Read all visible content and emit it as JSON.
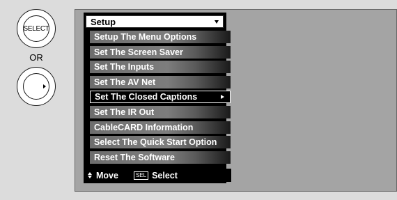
{
  "remote": {
    "select_button_label": "SELECT",
    "or_label": "OR",
    "nav_button_icon": "right-arrow-icon"
  },
  "menu": {
    "title": "Setup",
    "items": [
      {
        "label": "Setup The Menu Options"
      },
      {
        "label": "Set The Screen Saver"
      },
      {
        "label": "Set The Inputs"
      },
      {
        "label": "Set The AV Net"
      },
      {
        "label": "Set The Closed Captions",
        "selected": true
      },
      {
        "label": "Set The IR Out"
      },
      {
        "label": "CableCARD Information"
      },
      {
        "label": "Select The Quick Start Option"
      },
      {
        "label": "Reset The Software"
      }
    ]
  },
  "footer": {
    "move_label": "Move",
    "sel_key_label": "SEL",
    "select_label": "Select"
  },
  "colors": {
    "screen_bg": "#a4a4a4",
    "menu_bg": "#000000",
    "item_text": "#ffffff",
    "title_bg": "#ffffff"
  }
}
